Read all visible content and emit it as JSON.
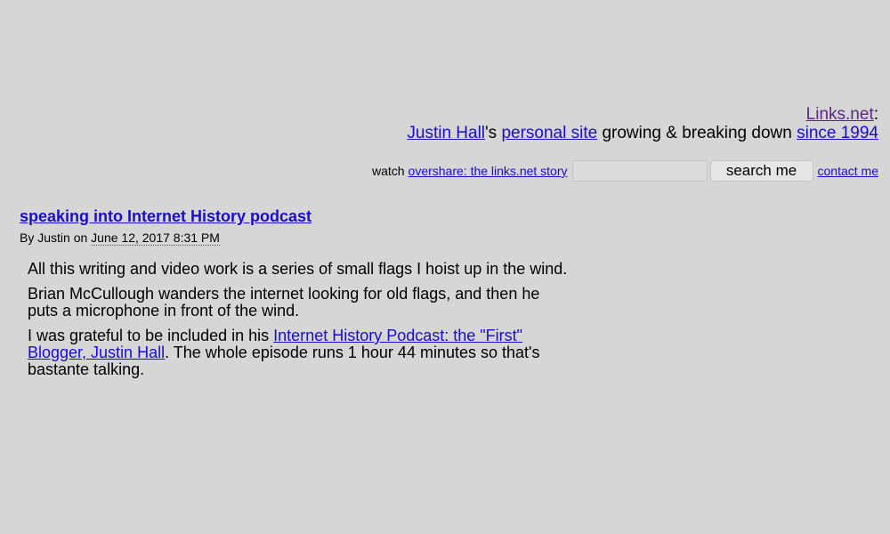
{
  "header": {
    "site_name": "Links.net",
    "colon": ":",
    "owner_link": "Justin Hall",
    "owner_suffix": "'s ",
    "personal_site_link": "personal site",
    "tagline_text": " growing & breaking down ",
    "since_link": "since 1994"
  },
  "toolbar": {
    "watch_label": "watch",
    "overshare_link": "overshare: the links.net story",
    "search_value": "",
    "search_button": "search me",
    "contact_link": "contact me"
  },
  "post": {
    "title": "speaking into Internet History podcast",
    "byline_prefix": "By Justin on",
    "date": "June 12, 2017 8:31 PM",
    "paragraphs": [
      "All this writing and video work is a series of small flags I hoist up in the wind.",
      "Brian McCullough wanders the internet looking for old flags, and then he puts a microphone in front of the wind."
    ],
    "p3_before": "I was grateful to be included in his ",
    "p3_link": "Internet History Podcast: the \"First\" Blogger, Justin Hall",
    "p3_after": ". The whole episode runs 1 hour 44 minutes so that's bastante talking."
  }
}
